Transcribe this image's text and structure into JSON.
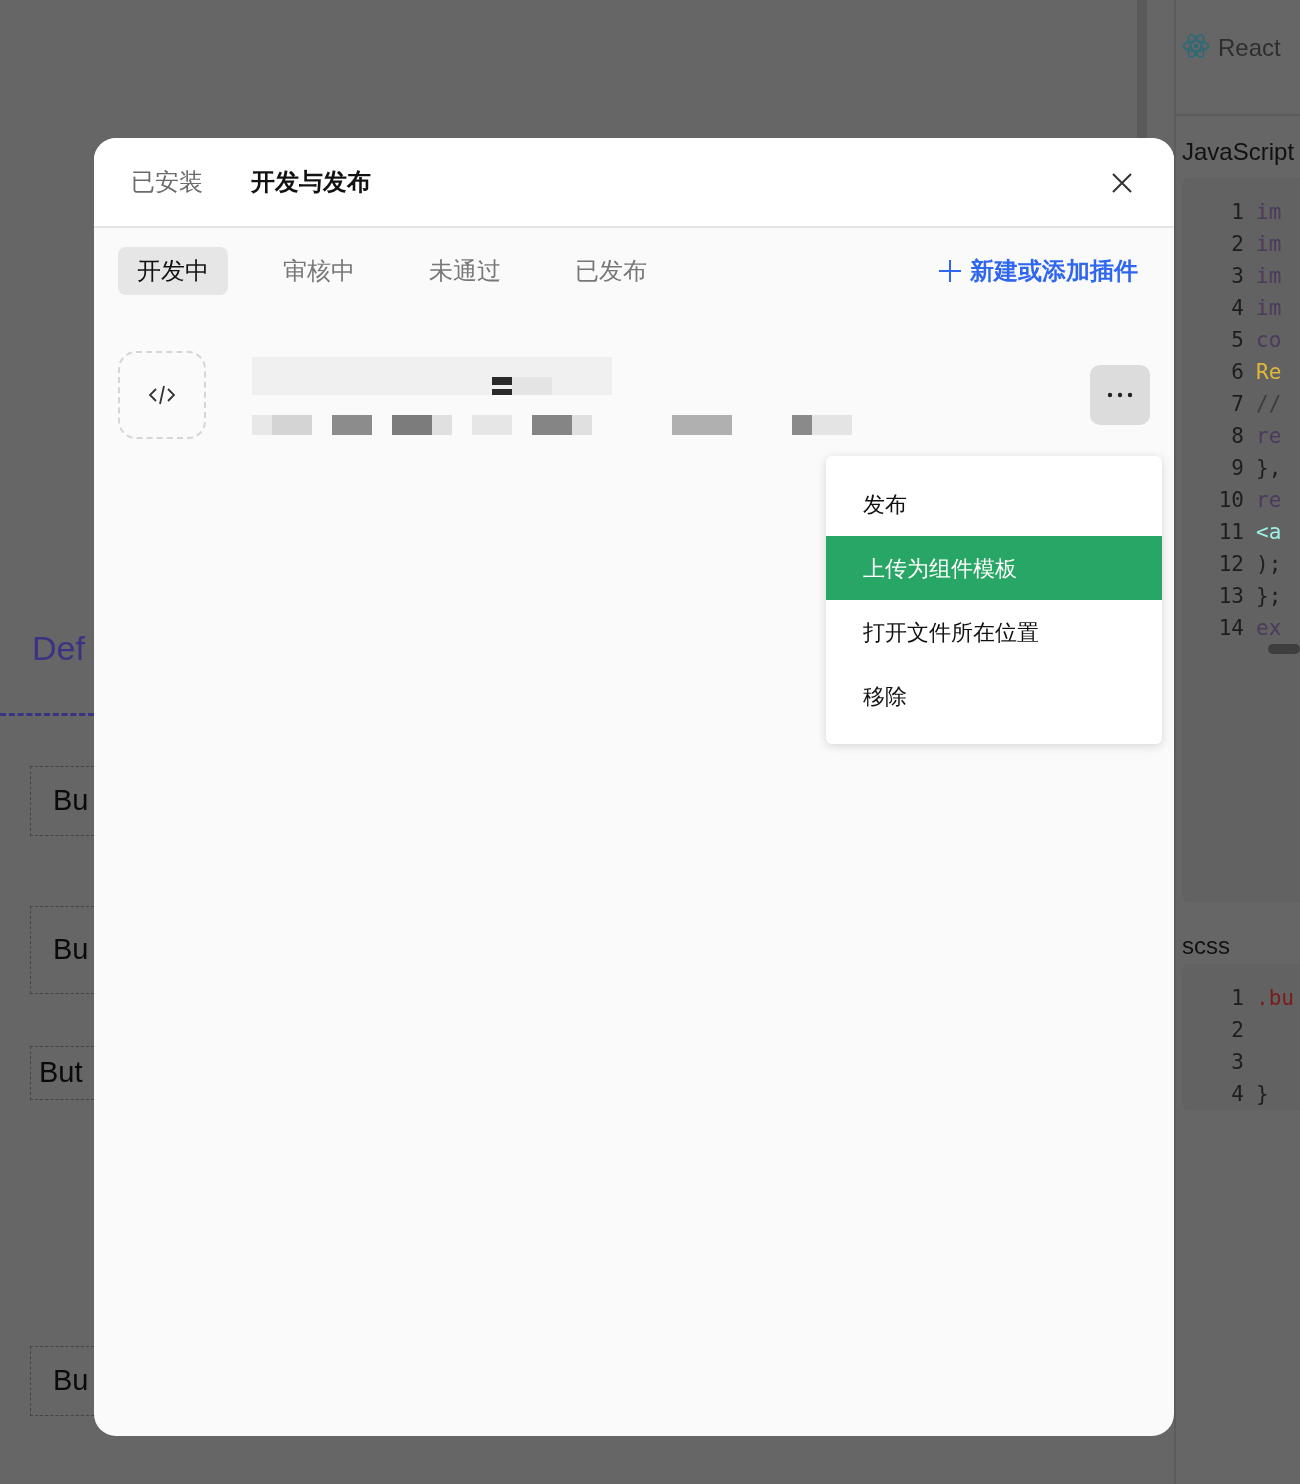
{
  "background": {
    "framework": "React",
    "section_title": "Def",
    "preview_buttons": [
      "Bu",
      "Bu",
      "But",
      "Bu"
    ],
    "code_panels": [
      {
        "language": "JavaScript",
        "lines": [
          {
            "number": "1",
            "code": "im",
            "color": "#4b3a5c"
          },
          {
            "number": "2",
            "code": "im",
            "color": "#4b3a5c"
          },
          {
            "number": "3",
            "code": "im",
            "color": "#4b3a5c"
          },
          {
            "number": "4",
            "code": "im",
            "color": "#4b3a5c"
          },
          {
            "number": "5",
            "code": "co",
            "color": "#4b3a5c"
          },
          {
            "number": "6",
            "code": "Re",
            "color": "#e0b838"
          },
          {
            "number": "7",
            "code": "//",
            "color": "#3c3c3c"
          },
          {
            "number": "8",
            "code": "re",
            "color": "#4b3a5c"
          },
          {
            "number": "9",
            "code": "},",
            "color": "#1e1e1e"
          },
          {
            "number": "10",
            "code": "re",
            "color": "#4b3a5c"
          },
          {
            "number": "11",
            "code": "<a",
            "color": "#9ff0e4"
          },
          {
            "number": "12",
            "code": ");",
            "color": "#1e1e1e"
          },
          {
            "number": "13",
            "code": "};",
            "color": "#1e1e1e"
          },
          {
            "number": "14",
            "code": "ex",
            "color": "#4b3a5c"
          }
        ]
      },
      {
        "language": "scss",
        "lines": [
          {
            "number": "1",
            "code": ".bu",
            "color": "#7a1c1c"
          },
          {
            "number": "2"
          },
          {
            "number": "3"
          },
          {
            "number": "4",
            "code": "}",
            "color": "#1e1e1e"
          }
        ]
      }
    ]
  },
  "modal": {
    "tabs": [
      {
        "label": "已安装",
        "selected": false
      },
      {
        "label": "开发与发布",
        "selected": true
      }
    ],
    "subtabs": [
      {
        "label": "开发中",
        "selected": true
      },
      {
        "label": "审核中",
        "selected": false
      },
      {
        "label": "未通过",
        "selected": false
      },
      {
        "label": "已发布",
        "selected": false
      }
    ],
    "add_button": "新建或添加插件",
    "menu": [
      {
        "label": "发布",
        "selected": false
      },
      {
        "label": "上传为组件模板",
        "selected": true
      },
      {
        "label": "打开文件所在位置",
        "selected": false
      },
      {
        "label": "移除",
        "selected": false
      }
    ]
  }
}
